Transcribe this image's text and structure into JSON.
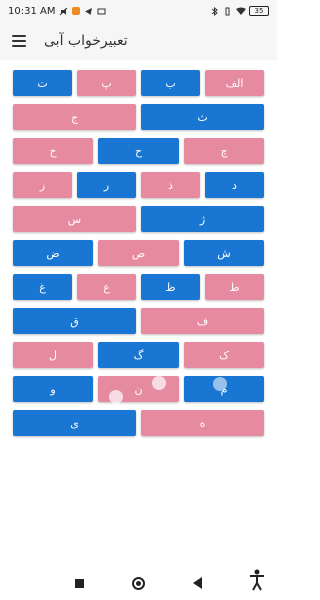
{
  "status": {
    "time": "10:31 AM",
    "icons": [
      "silent-icon",
      "notification-icon",
      "telegram-icon",
      "message-icon"
    ],
    "right_icons": [
      "bluetooth-icon",
      "vibrate-icon",
      "wifi-icon"
    ],
    "battery": "35"
  },
  "app": {
    "title": "تعبیرخواب آبی"
  },
  "letters": {
    "alef": "الف",
    "be": "ب",
    "pe": "پ",
    "te": "ت",
    "se": "ث",
    "jim": "ج",
    "che": "چ",
    "he": "ح",
    "khe": "خ",
    "dal": "د",
    "zal": "ذ",
    "re": "ر",
    "ze": "ز",
    "zhe": "ژ",
    "sin": "س",
    "shin": "ش",
    "sad": "ص",
    "zad": "ض",
    "ta": "ط",
    "za": "ظ",
    "eyn": "ع",
    "gheyn": "غ",
    "fe": "ف",
    "ghaf": "ق",
    "kaf": "ک",
    "gaf": "گ",
    "lam": "ل",
    "mim": "م",
    "nun": "ن",
    "vav": "و",
    "he2": "ه",
    "ye": "ی"
  },
  "colors": {
    "blue": "#1976d2",
    "pink": "#e68aa0"
  }
}
